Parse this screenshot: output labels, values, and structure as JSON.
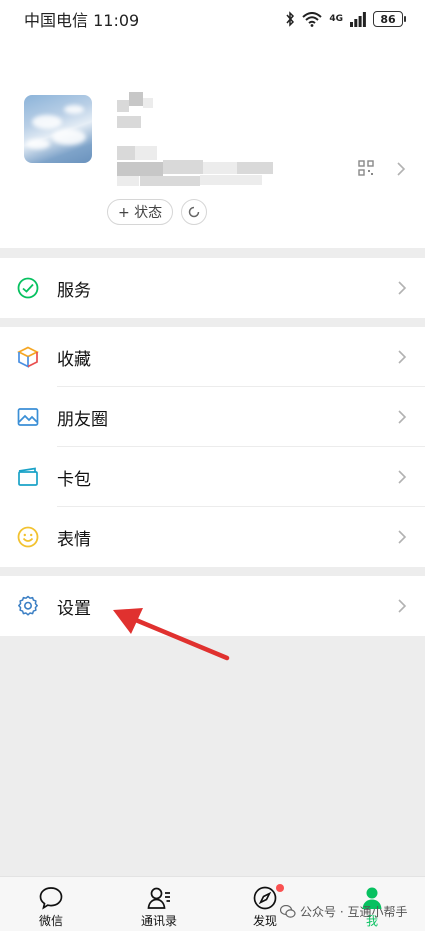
{
  "status_bar": {
    "carrier_time": "中国电信 11:09",
    "network": "4G",
    "battery": "86"
  },
  "profile": {
    "status_button": "+ 状态"
  },
  "groups": {
    "service": {
      "label": "服务"
    },
    "collection": [
      {
        "label": "收藏",
        "icon": "cube-icon"
      },
      {
        "label": "朋友圈",
        "icon": "image-icon"
      },
      {
        "label": "卡包",
        "icon": "card-wallet-icon"
      },
      {
        "label": "表情",
        "icon": "smile-icon"
      }
    ],
    "settings": {
      "label": "设置"
    }
  },
  "tab_bar": {
    "tabs": [
      {
        "label": "微信",
        "icon": "chat-bubble-icon"
      },
      {
        "label": "通讯录",
        "icon": "contacts-icon"
      },
      {
        "label": "发现",
        "icon": "compass-icon"
      },
      {
        "label": "我",
        "icon": "person-icon"
      }
    ],
    "active": "我"
  },
  "watermark": "公众号 · 互通小帮手",
  "colors": {
    "accent": "#07c160",
    "red": "#e0312f",
    "background": "#ededed"
  }
}
